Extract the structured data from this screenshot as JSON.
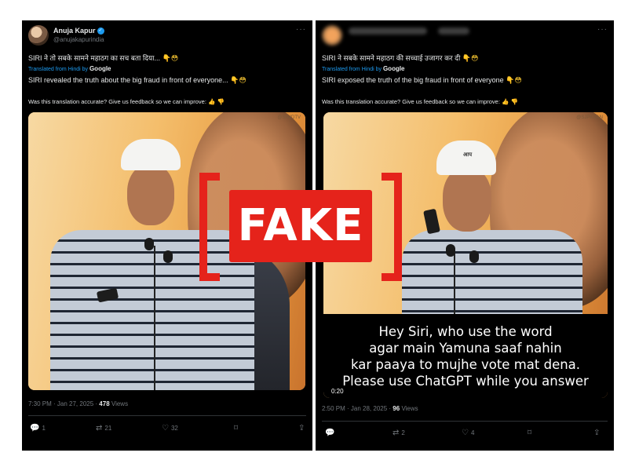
{
  "left_post": {
    "author_name": "Anuja Kapur",
    "author_handle": "@anujakapurindia",
    "more": "···",
    "text_hindi": "SIRI ने तो सबके सामने महाठग का सच बता दिया...",
    "translated_label": "Translated from Hindi by",
    "translated_brand": "Google",
    "text_english": "SIRI revealed the truth about the big fraud in front of everyone...",
    "feedback": "Was this translation accurate? Give us feedback so we can improve:",
    "watermark": "@SAVDTV",
    "time": "7:30 PM · Jan 27, 2025 ·",
    "views": "478",
    "views_label": "Views",
    "replies": "1",
    "reposts": "21",
    "likes": "32"
  },
  "right_post": {
    "more": "···",
    "text_hindi": "SIRI ने सबके सामने महाठग की सच्चाई उजागर कर दी",
    "translated_label": "Translated from Hindi by",
    "translated_brand": "Google",
    "text_english": "SIRI exposed the truth of the big fraud in front of everyone",
    "feedback": "Was this translation accurate? Give us feedback so we can improve:",
    "watermark": "@SJPKNAN",
    "cap_text": "आप",
    "caption_lines": [
      "Hey Siri, who use the word",
      "agar main Yamuna saaf nahin",
      "kar paaya to mujhe vote mat dena.",
      "Please use ChatGPT while you answer"
    ],
    "video_time": "0:20",
    "time": "2:50 PM · Jan 28, 2025 ·",
    "views": "96",
    "views_label": "Views",
    "reposts": "2",
    "likes": "4"
  },
  "stamp": {
    "label": "FAKE"
  },
  "icons": {
    "reply": "reply-icon",
    "repost": "repost-icon",
    "like": "heart-icon",
    "bookmark": "bookmark-icon",
    "share": "share-icon",
    "like_feedback": "thumbs-up-icon",
    "dislike_feedback": "thumbs-down-icon"
  },
  "colors": {
    "stamp_red": "#e5231b",
    "link_blue": "#1d9bf0",
    "panel_bg": "#000000"
  }
}
